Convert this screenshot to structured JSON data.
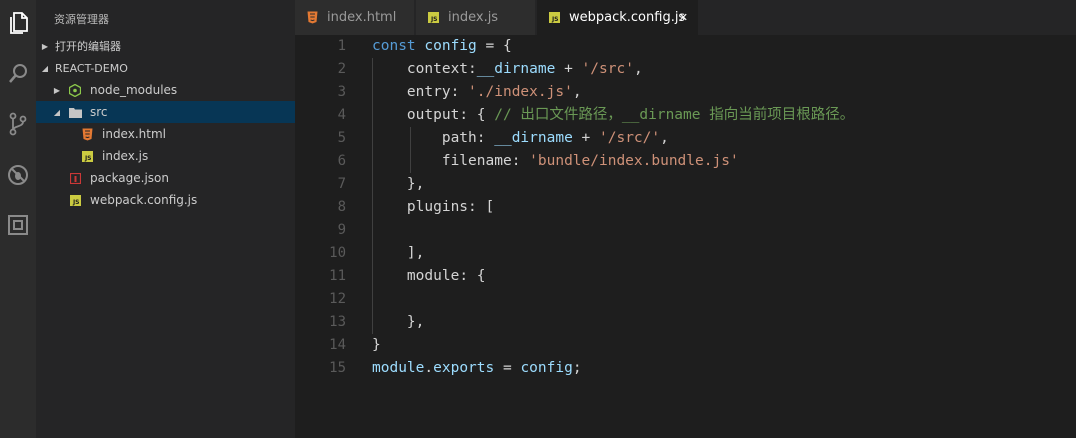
{
  "activity_bar": {
    "icons": [
      "files-icon",
      "search-icon",
      "source-control-icon",
      "debug-icon",
      "extensions-icon"
    ]
  },
  "sidebar": {
    "title": "资源管理器",
    "open_editors_label": "打开的编辑器",
    "project_label": "REACT-DEMO",
    "tree": [
      {
        "label": "node_modules",
        "type": "folder-node",
        "depth": 1
      },
      {
        "label": "src",
        "type": "folder",
        "depth": 1
      },
      {
        "label": "index.html",
        "type": "html",
        "depth": 2
      },
      {
        "label": "index.js",
        "type": "js",
        "depth": 2
      },
      {
        "label": "package.json",
        "type": "json",
        "depth": 1
      },
      {
        "label": "webpack.config.js",
        "type": "js",
        "depth": 1
      }
    ]
  },
  "tabs": [
    {
      "label": "index.html",
      "type": "html"
    },
    {
      "label": "index.js",
      "type": "js"
    },
    {
      "label": "webpack.config.js",
      "type": "js",
      "close": "✕"
    }
  ],
  "editor": {
    "line_numbers": [
      "1",
      "2",
      "3",
      "4",
      "5",
      "6",
      "7",
      "8",
      "9",
      "10",
      "11",
      "12",
      "13",
      "14",
      "15"
    ],
    "lines": [
      [
        [
          "kw",
          "const"
        ],
        [
          "pn",
          " "
        ],
        [
          "vr",
          "config"
        ],
        [
          "pn",
          " = {"
        ]
      ],
      [
        [
          "pn",
          "    "
        ],
        [
          "pr",
          "context"
        ],
        [
          "pn",
          ":"
        ],
        [
          "vr",
          "__dirname"
        ],
        [
          "pn",
          " + "
        ],
        [
          "st",
          "'/src'"
        ],
        [
          "pn",
          ","
        ]
      ],
      [
        [
          "pn",
          "    "
        ],
        [
          "pr",
          "entry"
        ],
        [
          "pn",
          ": "
        ],
        [
          "st",
          "'./index.js'"
        ],
        [
          "pn",
          ","
        ]
      ],
      [
        [
          "pn",
          "    "
        ],
        [
          "pr",
          "output"
        ],
        [
          "pn",
          ": { "
        ],
        [
          "cm",
          "// 出口文件路径，__dirname 指向当前项目根路径。"
        ]
      ],
      [
        [
          "pn",
          "        "
        ],
        [
          "pr",
          "path"
        ],
        [
          "pn",
          ": "
        ],
        [
          "vr",
          "__dirname"
        ],
        [
          "pn",
          " + "
        ],
        [
          "st",
          "'/src/'"
        ],
        [
          "pn",
          ","
        ]
      ],
      [
        [
          "pn",
          "        "
        ],
        [
          "pr",
          "filename"
        ],
        [
          "pn",
          ": "
        ],
        [
          "st",
          "'bundle/index.bundle.js'"
        ]
      ],
      [
        [
          "pn",
          "    },"
        ]
      ],
      [
        [
          "pn",
          "    "
        ],
        [
          "pr",
          "plugins"
        ],
        [
          "pn",
          ": ["
        ]
      ],
      [
        [
          "pn",
          ""
        ]
      ],
      [
        [
          "pn",
          "    ],"
        ]
      ],
      [
        [
          "pn",
          "    "
        ],
        [
          "pr",
          "module"
        ],
        [
          "pn",
          ": {"
        ]
      ],
      [
        [
          "pn",
          ""
        ]
      ],
      [
        [
          "pn",
          "    },"
        ]
      ],
      [
        [
          "pn",
          "}"
        ]
      ],
      [
        [
          "vr",
          "module"
        ],
        [
          "pn",
          "."
        ],
        [
          "vr",
          "exports"
        ],
        [
          "pn",
          " = "
        ],
        [
          "vr",
          "config"
        ],
        [
          "pn",
          ";"
        ]
      ]
    ]
  }
}
